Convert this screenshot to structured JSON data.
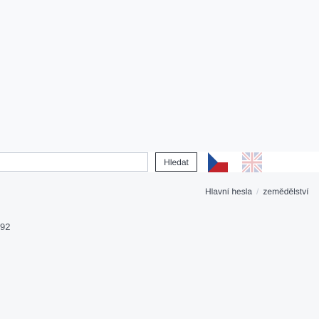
{
  "search": {
    "value": "",
    "button_label": "Hledat"
  },
  "languages": [
    {
      "name": "czech-flag-icon"
    },
    {
      "name": "english-flag-icon"
    }
  ],
  "breadcrumb": {
    "items": [
      "Hlavní hesla",
      "zemědělství"
    ],
    "separator": "/"
  },
  "side_number": "92"
}
